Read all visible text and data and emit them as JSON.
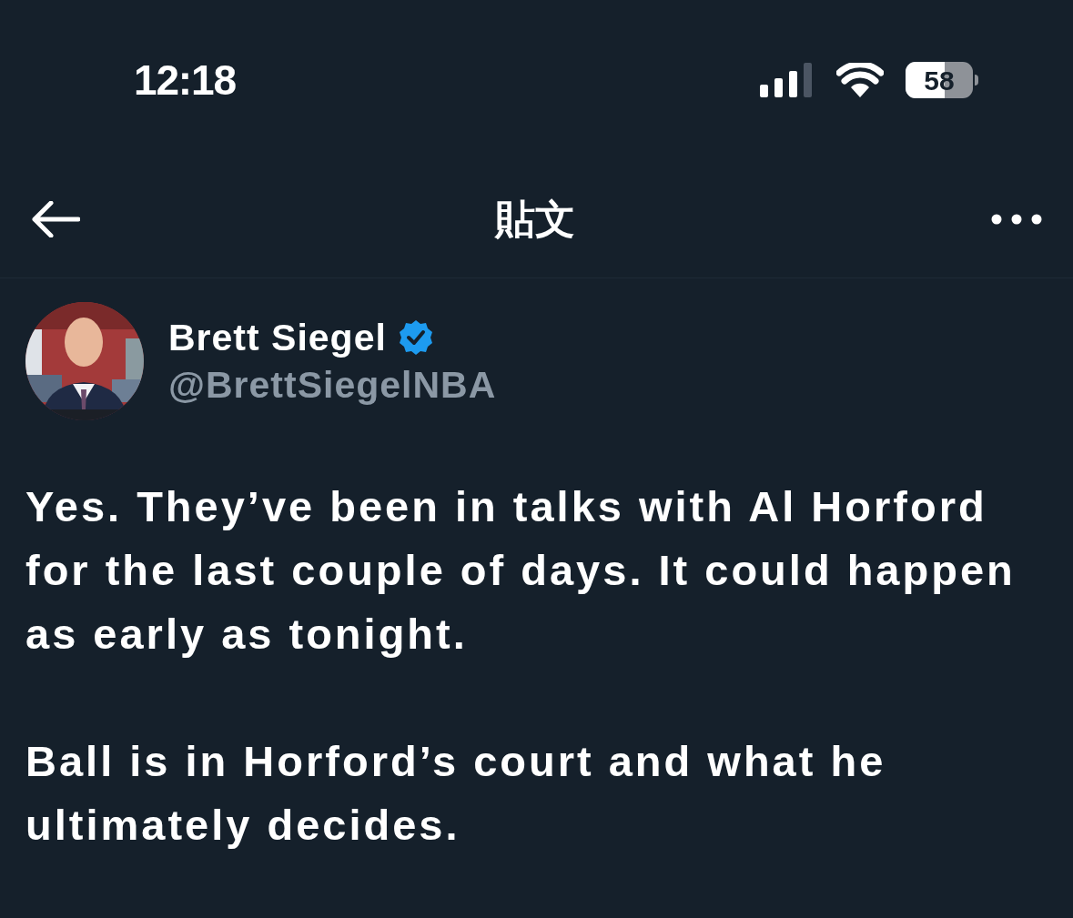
{
  "status_bar": {
    "time": "12:18",
    "battery": "58"
  },
  "header": {
    "title": "貼文"
  },
  "post": {
    "author": {
      "name": "Brett Siegel",
      "verified": true,
      "handle": "@BrettSiegelNBA"
    },
    "paragraphs": [
      "Yes. They’ve been in talks with Al Horford for the last couple of days. It could happen as early as tonight.",
      "Ball is in Horford’s court and what he ultimately decides."
    ]
  }
}
